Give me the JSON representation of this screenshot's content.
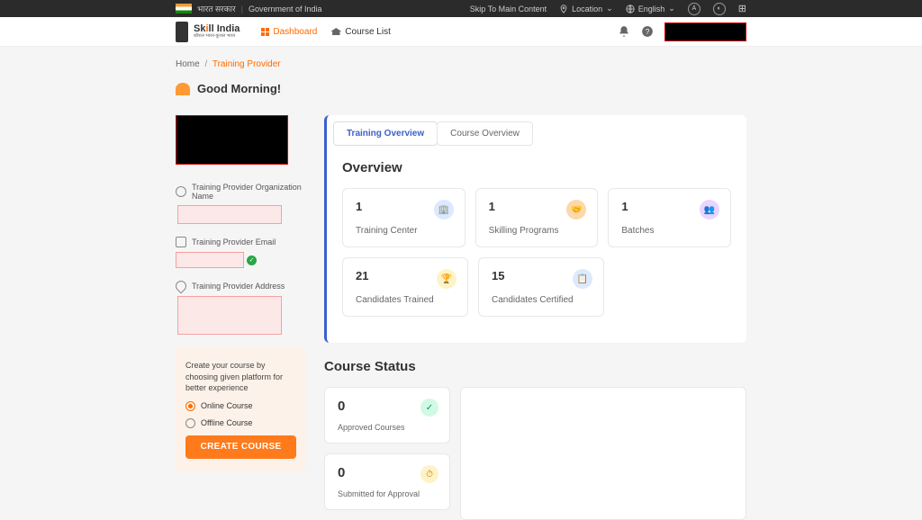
{
  "topbar": {
    "hindi": "भारत सरकार",
    "english": "Government of India",
    "skip": "Skip To Main Content",
    "location": "Location",
    "language": "English",
    "a_label": "A"
  },
  "navbar": {
    "logo_main": "Skill India",
    "logo_sub": "कौशल भारत-कुशल भारत",
    "dashboard": "Dashboard",
    "course_list": "Course List"
  },
  "breadcrumb": {
    "home": "Home",
    "current": "Training Provider"
  },
  "greeting": "Good Morning!",
  "fields": {
    "org_label": "Training Provider Organization Name",
    "email_label": "Training Provider Email",
    "address_label": "Training Provider Address"
  },
  "create": {
    "text": "Create your course by choosing given platform for better experience",
    "opt1": "Online Course",
    "opt2": "Offline Course",
    "button": "CREATE COURSE"
  },
  "tabs": {
    "training": "Training Overview",
    "course": "Course Overview"
  },
  "overview": {
    "title": "Overview",
    "cards": [
      {
        "num": "1",
        "label": "Training Center"
      },
      {
        "num": "1",
        "label": "Skilling Programs"
      },
      {
        "num": "1",
        "label": "Batches"
      },
      {
        "num": "21",
        "label": "Candidates Trained"
      },
      {
        "num": "15",
        "label": "Candidates Certified"
      }
    ]
  },
  "course_status": {
    "title": "Course Status",
    "approved": {
      "num": "0",
      "label": "Approved Courses"
    },
    "submitted": {
      "num": "0",
      "label": "Submitted for Approval"
    }
  }
}
